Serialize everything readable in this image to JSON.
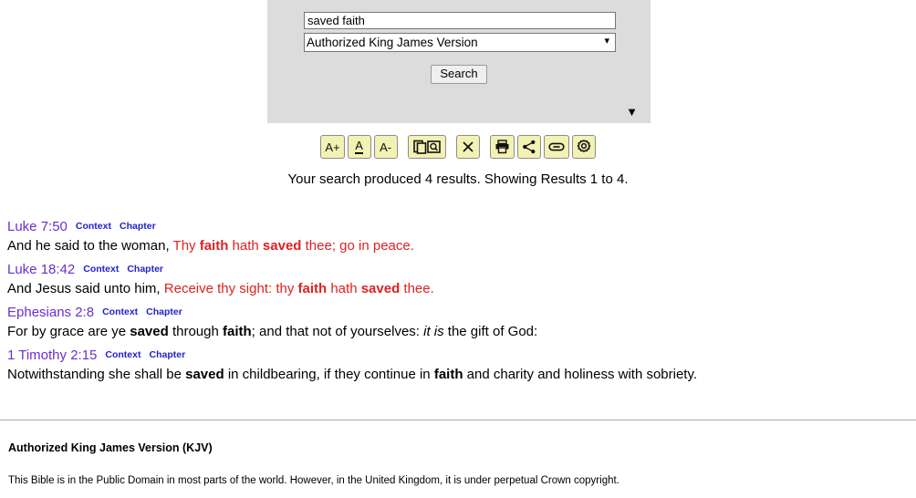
{
  "search": {
    "query_value": "saved faith",
    "query_placeholder": "",
    "version_selected": "Authorized King James Version",
    "version_options": [
      "Authorized King James Version"
    ],
    "search_label": "Search",
    "panel_toggle_icon": "▼"
  },
  "toolbar": {
    "buttons": [
      {
        "name": "font-increase-icon",
        "label": "A+",
        "kind": "text"
      },
      {
        "name": "font-underline-icon",
        "label": "A",
        "kind": "underline"
      },
      {
        "name": "font-decrease-icon",
        "label": "A-",
        "kind": "text"
      },
      {
        "name": "compare-view-icon",
        "label": "",
        "kind": "compare"
      },
      {
        "name": "close-icon",
        "label": "✕",
        "kind": "text"
      },
      {
        "name": "print-icon",
        "label": "",
        "kind": "print"
      },
      {
        "name": "share-icon",
        "label": "",
        "kind": "share"
      },
      {
        "name": "link-icon",
        "label": "",
        "kind": "link"
      },
      {
        "name": "settings-gear-icon",
        "label": "",
        "kind": "gear"
      }
    ]
  },
  "results": {
    "count_text": "Your search produced 4 results.  Showing Results 1 to 4.",
    "context_label": "Context",
    "chapter_label": "Chapter",
    "verses": [
      {
        "reference": "Luke 7:50",
        "segments": [
          {
            "text": "And he said to the woman,",
            "red": false,
            "bold": false,
            "italic": false
          },
          {
            "text": " ",
            "red": false,
            "bold": false,
            "italic": false
          },
          {
            "text": "Thy ",
            "red": true,
            "bold": false,
            "italic": false
          },
          {
            "text": "faith",
            "red": true,
            "bold": true,
            "italic": false
          },
          {
            "text": " hath ",
            "red": true,
            "bold": false,
            "italic": false
          },
          {
            "text": "saved",
            "red": true,
            "bold": true,
            "italic": false
          },
          {
            "text": " thee; go in peace.",
            "red": true,
            "bold": false,
            "italic": false
          }
        ]
      },
      {
        "reference": "Luke 18:42",
        "segments": [
          {
            "text": "And Jesus said unto him,",
            "red": false,
            "bold": false,
            "italic": false
          },
          {
            "text": " ",
            "red": false,
            "bold": false,
            "italic": false
          },
          {
            "text": "Receive thy sight: thy ",
            "red": true,
            "bold": false,
            "italic": false
          },
          {
            "text": "faith",
            "red": true,
            "bold": true,
            "italic": false
          },
          {
            "text": " hath ",
            "red": true,
            "bold": false,
            "italic": false
          },
          {
            "text": "saved",
            "red": true,
            "bold": true,
            "italic": false
          },
          {
            "text": " thee.",
            "red": true,
            "bold": false,
            "italic": false
          }
        ]
      },
      {
        "reference": "Ephesians 2:8",
        "segments": [
          {
            "text": "For by grace are ye ",
            "red": false,
            "bold": false,
            "italic": false
          },
          {
            "text": "saved",
            "red": false,
            "bold": true,
            "italic": false
          },
          {
            "text": " through ",
            "red": false,
            "bold": false,
            "italic": false
          },
          {
            "text": "faith",
            "red": false,
            "bold": true,
            "italic": false
          },
          {
            "text": "; and that not of yourselves: ",
            "red": false,
            "bold": false,
            "italic": false
          },
          {
            "text": "it is",
            "red": false,
            "bold": false,
            "italic": true
          },
          {
            "text": " the gift of God:",
            "red": false,
            "bold": false,
            "italic": false
          }
        ]
      },
      {
        "reference": "1 Timothy 2:15",
        "segments": [
          {
            "text": "Notwithstanding she shall be ",
            "red": false,
            "bold": false,
            "italic": false
          },
          {
            "text": "saved",
            "red": false,
            "bold": true,
            "italic": false
          },
          {
            "text": " in childbearing, if they continue in ",
            "red": false,
            "bold": false,
            "italic": false
          },
          {
            "text": "faith",
            "red": false,
            "bold": true,
            "italic": false
          },
          {
            "text": " and charity and holiness with sobriety.",
            "red": false,
            "bold": false,
            "italic": false
          }
        ]
      }
    ]
  },
  "footer": {
    "title": "Authorized King James Version (KJV)",
    "copyright": "This Bible is in the Public Domain in most parts of the world.  However, in the United Kingdom, it is under perpetual Crown copyright."
  },
  "colors": {
    "panel_bg": "#dcdcdc",
    "toolbar_button_bg": "#f2f2b4",
    "reference": "#6b2fcf",
    "link": "#2222cc",
    "words_of_jesus": "#dd2222"
  }
}
